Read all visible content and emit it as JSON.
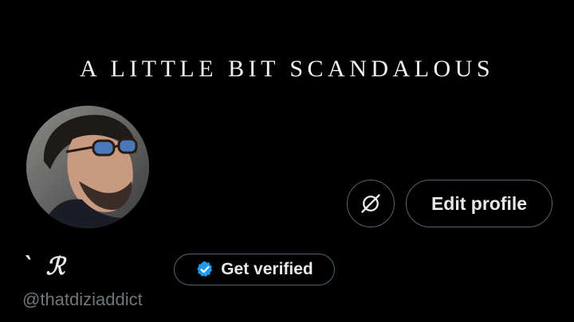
{
  "banner": {
    "text": "A LITTLE BIT SCANDALOUS"
  },
  "profile": {
    "display_name": "` ℛ",
    "handle": "@thatdiziaddict"
  },
  "actions": {
    "edit_label": "Edit profile",
    "verify_label": "Get verified",
    "secondary_icon": "reach-icon"
  },
  "colors": {
    "background": "#000000",
    "text_primary": "#e7e9ea",
    "text_secondary": "#71767b",
    "border": "#536471",
    "verified_blue": "#1d9bf0"
  }
}
